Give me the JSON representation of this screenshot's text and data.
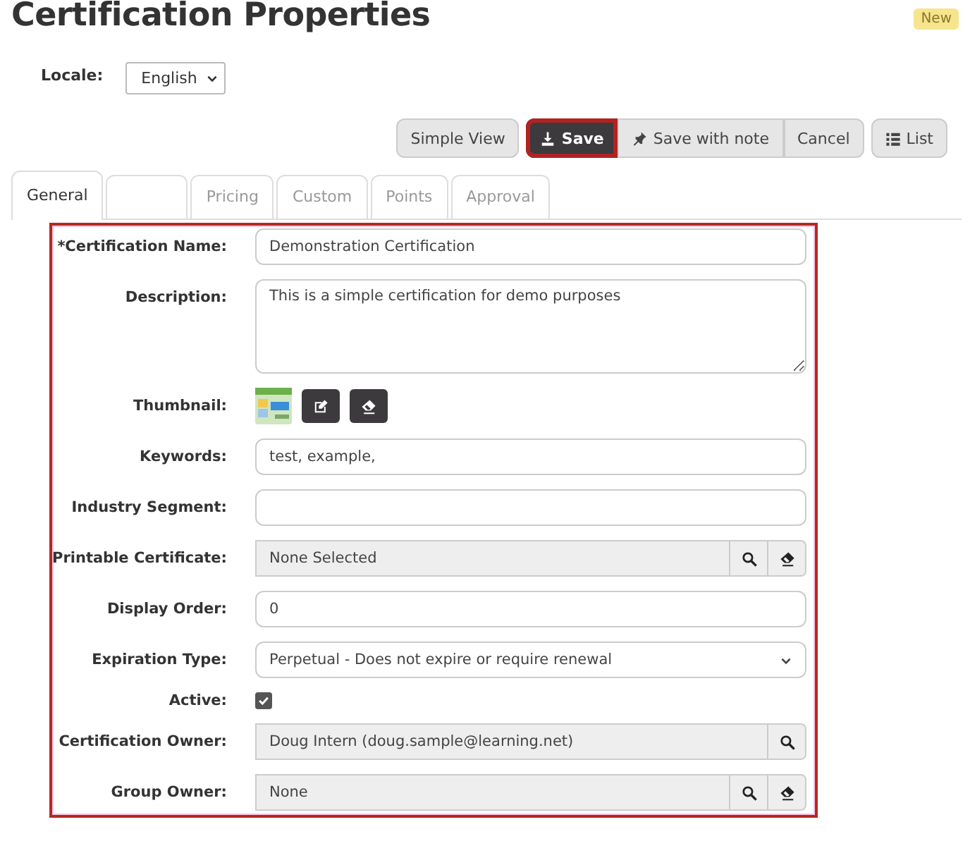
{
  "page": {
    "title": "Certification Properties",
    "badge": "New"
  },
  "locale": {
    "label": "Locale:",
    "value": "English"
  },
  "buttons": [
    {
      "label": "Simple View",
      "kind": "view",
      "highlighted": false
    },
    {
      "label": "Save",
      "kind": "save",
      "highlighted": true
    },
    {
      "label": "Save with note",
      "kind": "note",
      "highlighted": false
    },
    {
      "label": "Cancel",
      "kind": "cancel",
      "highlighted": false
    },
    {
      "label": "List",
      "kind": "list",
      "highlighted": false
    }
  ],
  "tabs": [
    {
      "label": "General",
      "selected": true
    },
    {
      "selected": false
    },
    {
      "label": "Pricing",
      "selected": false
    },
    {
      "label": "Custom",
      "selected": false
    },
    {
      "label": "Points",
      "selected": false
    },
    {
      "label": "Approval",
      "selected": false
    }
  ],
  "form": {
    "highlighted": true,
    "fields": [
      {
        "kind": "text",
        "label": "*Certification Name:",
        "value": "Demonstration Certification"
      },
      {
        "kind": "textarea",
        "label": "Description:",
        "value": "This is a simple certification for demo purposes"
      },
      {
        "kind": "thumbnail",
        "label": "Thumbnail:"
      },
      {
        "kind": "text",
        "label": "Keywords:",
        "value": "test, example,"
      },
      {
        "kind": "text",
        "label": "Industry Segment:"
      },
      {
        "kind": "lookup",
        "label": "Printable Certificate:",
        "value": "None Selected",
        "clearable": true
      },
      {
        "kind": "text",
        "label": "Display Order:",
        "value": "0"
      },
      {
        "kind": "select",
        "label": "Expiration Type:",
        "value": "Perpetual - Does not expire or require renewal"
      },
      {
        "kind": "checkbox",
        "label": "Active:",
        "checked": true
      },
      {
        "kind": "lookup",
        "label": "Certification Owner:",
        "value": "Doug Intern (doug.sample@learning.net)",
        "clearable": false
      },
      {
        "kind": "lookup",
        "label": "Group Owner:",
        "value": "None",
        "clearable": true
      }
    ]
  }
}
